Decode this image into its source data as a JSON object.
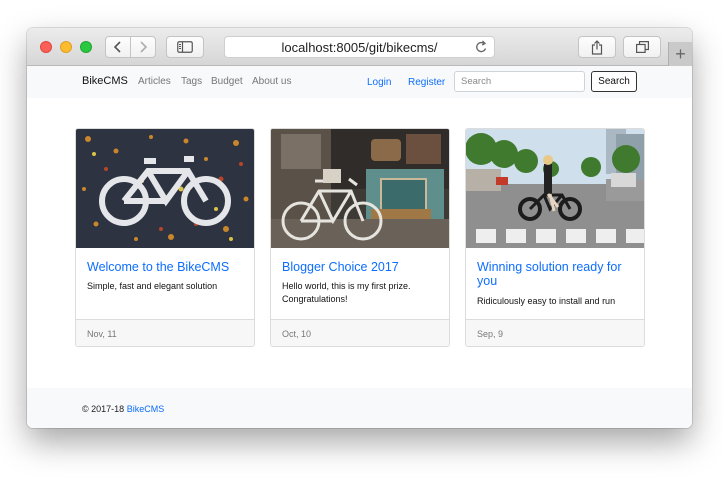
{
  "browser": {
    "url": "localhost:8005/git/bikecms/",
    "newtab_glyph": "+"
  },
  "nav": {
    "brand": "BikeCMS",
    "links": [
      "Articles",
      "Tags",
      "Budget",
      "About us"
    ],
    "login": "Login",
    "register": "Register",
    "search_placeholder": "Search",
    "search_button": "Search"
  },
  "cards": [
    {
      "title": "Welcome to the BikeCMS",
      "text": "Simple, fast and elegant solution",
      "date": "Nov, 11",
      "image": "bike-lane-marking-with-leaves"
    },
    {
      "title": "Blogger Choice 2017",
      "text": "Hello world, this is my first prize. Congratulations!",
      "date": "Oct, 10",
      "image": "white-bike-at-vintage-shop"
    },
    {
      "title": "Winning solution ready for you",
      "text": "Ridiculously easy to install and run",
      "date": "Sep, 9",
      "image": "woman-with-e-bike-on-street"
    }
  ],
  "footer": {
    "copyright": "© 2017-18",
    "link": "BikeCMS"
  },
  "colors": {
    "link": "#0d6efd",
    "navbar_bg": "#f8f9fa",
    "traffic_red": "#fc5f57",
    "traffic_yellow": "#fdbc2e",
    "traffic_green": "#28c840"
  }
}
